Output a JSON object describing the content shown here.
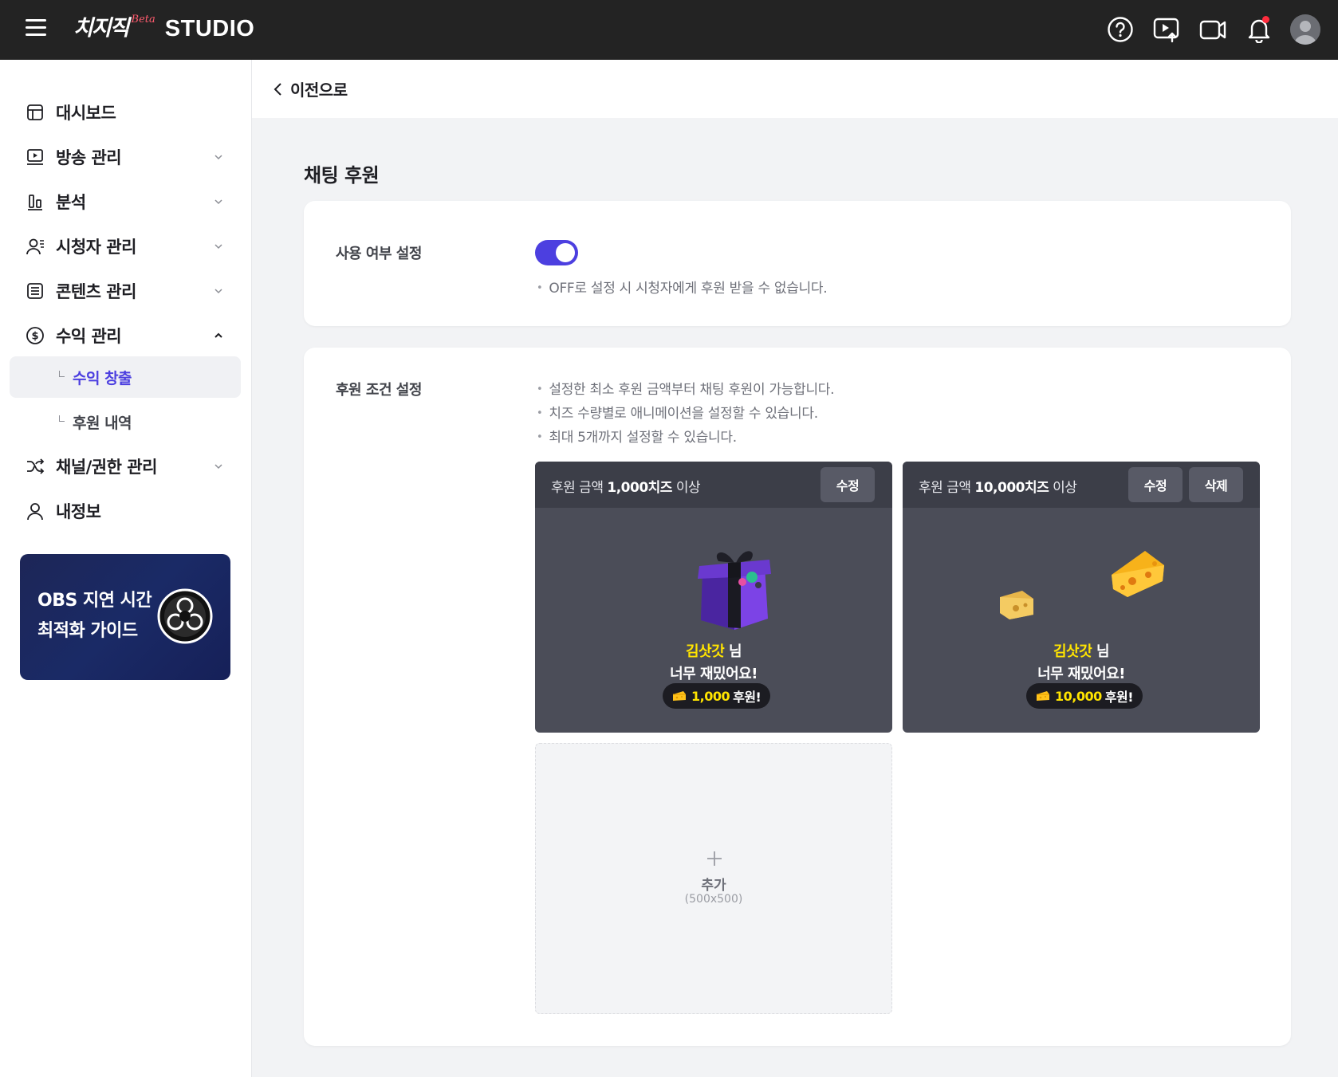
{
  "header": {
    "logo_main": "치지직",
    "logo_beta": "Beta",
    "logo_studio": "STUDIO",
    "icons": [
      "help-icon",
      "broadcast-upload-icon",
      "video-camera-icon",
      "bell-icon",
      "avatar"
    ]
  },
  "sidebar": {
    "items": [
      {
        "label": "대시보드",
        "icon": "dashboard-icon",
        "expandable": false
      },
      {
        "label": "방송 관리",
        "icon": "broadcast-monitor-icon",
        "expandable": true
      },
      {
        "label": "분석",
        "icon": "bar-chart-icon",
        "expandable": true
      },
      {
        "label": "시청자 관리",
        "icon": "viewer-icon",
        "expandable": true
      },
      {
        "label": "콘텐츠 관리",
        "icon": "content-list-icon",
        "expandable": true
      },
      {
        "label": "수익 관리",
        "icon": "dollar-circle-icon",
        "expandable": true,
        "expanded": true
      },
      {
        "label": "채널/권한 관리",
        "icon": "shuffle-icon",
        "expandable": true
      },
      {
        "label": "내정보",
        "icon": "user-icon",
        "expandable": false
      }
    ],
    "sub_items": [
      {
        "label": "수익 창출",
        "active": true
      },
      {
        "label": "후원 내역",
        "active": false
      }
    ],
    "banner": {
      "line1": "OBS 지연 시간",
      "line2": "최적화 가이드"
    }
  },
  "main": {
    "back_label": "이전으로",
    "page_title": "채팅 후원",
    "usage": {
      "label": "사용 여부 설정",
      "toggle_on": true,
      "note": "OFF로 설정 시 시청자에게 후원 받을 수 없습니다."
    },
    "conditions": {
      "label": "후원 조건 설정",
      "notes": [
        "설정한 최소 후원 금액부터 채팅 후원이 가능합니다.",
        "치즈 수량별로 애니메이션을 설정할 수 있습니다.",
        "최대 5개까지 설정할 수 있습니다."
      ],
      "tiles": [
        {
          "title_prefix": "후원 금액 ",
          "title_amount": "1,000치즈",
          "title_suffix": " 이상",
          "edit_label": "수정",
          "delete_label": "",
          "donor_name": "김삿갓",
          "donor_suffix": " 님",
          "message": "너무 재밌어요!",
          "amount": "1,000",
          "amount_suffix": "후원!",
          "animation": "gift-box"
        },
        {
          "title_prefix": "후원 금액 ",
          "title_amount": "10,000치즈",
          "title_suffix": " 이상",
          "edit_label": "수정",
          "delete_label": "삭제",
          "donor_name": "김삿갓",
          "donor_suffix": " 님",
          "message": "너무 재밌어요!",
          "amount": "10,000",
          "amount_suffix": "후원!",
          "animation": "cheese"
        }
      ],
      "add_tile": {
        "label": "추가",
        "size": "(500x500)"
      }
    }
  },
  "colors": {
    "accent": "#4c3fe0",
    "header_bg": "#232323",
    "tile_bg": "#4b4d58",
    "donor_name": "#ffe400"
  }
}
